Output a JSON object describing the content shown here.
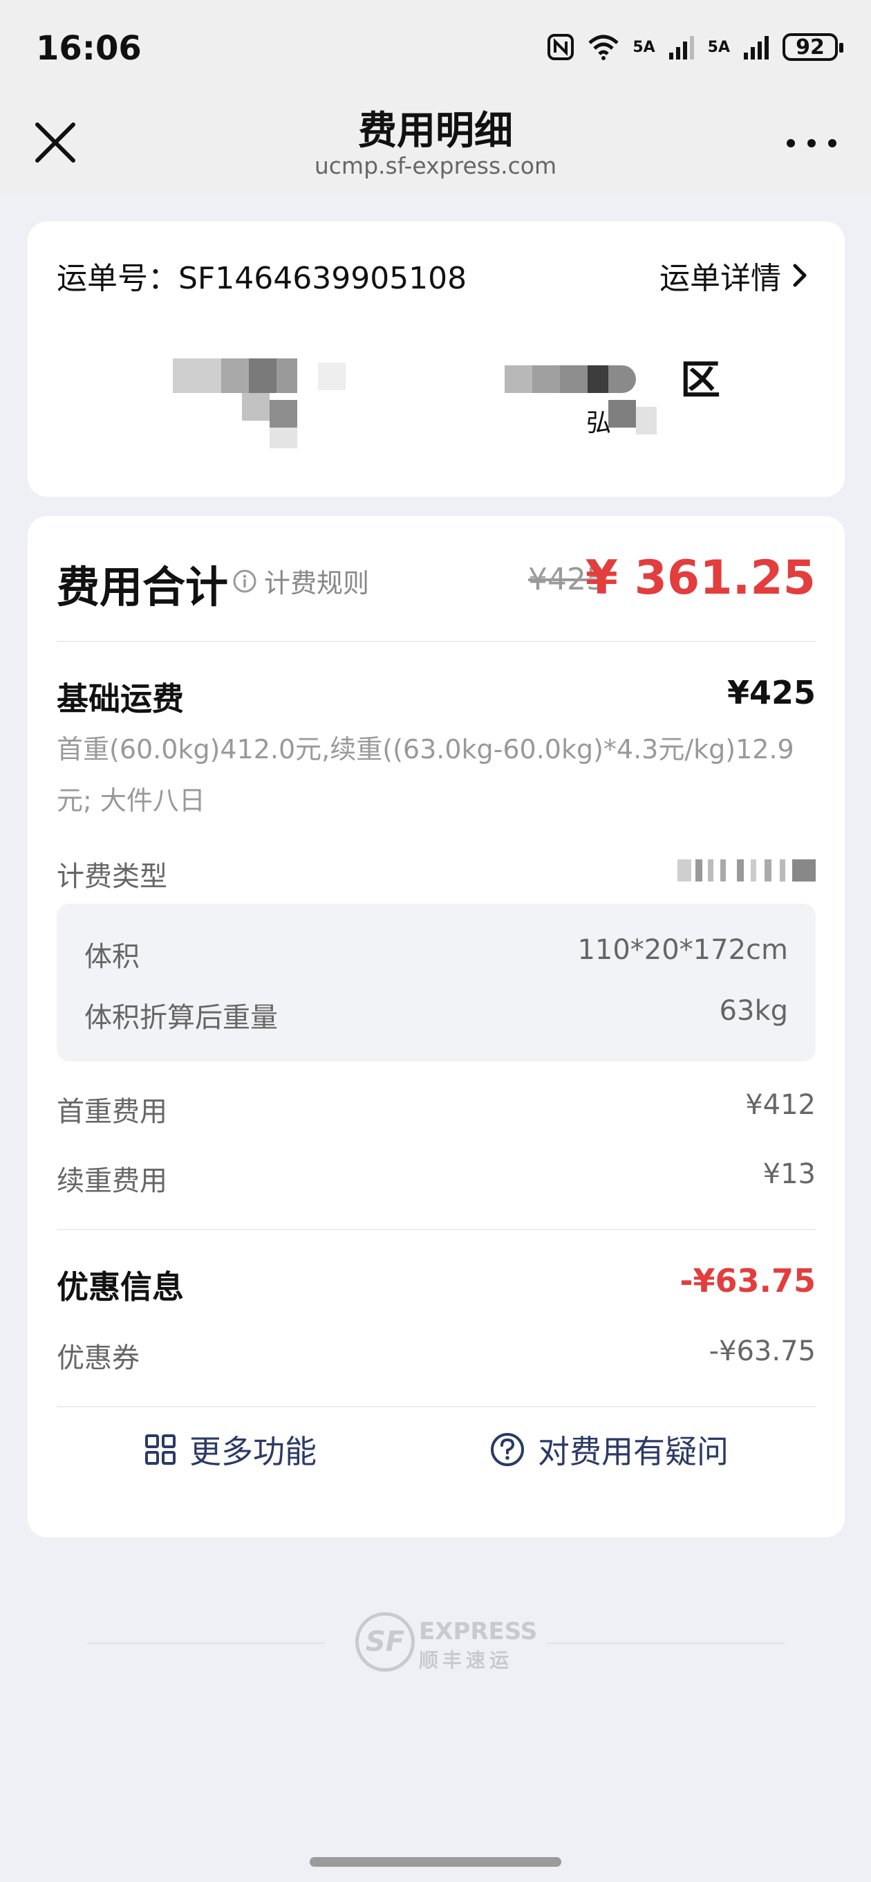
{
  "status_bar": {
    "time": "16:06",
    "network_label_1": "5A",
    "network_label_2": "5A",
    "battery": "92"
  },
  "nav": {
    "title": "费用明细",
    "url": "ucmp.sf-express.com"
  },
  "waybill": {
    "number_label": "运单号：SF1464639905108",
    "detail_link": "运单详情",
    "dest_addr_fragment": "区",
    "dest_sub_fragment": "弘"
  },
  "fees": {
    "total_label": "费用合计",
    "rule_link": "计费规则",
    "original_price": "¥425",
    "final_price": "¥ 361.25",
    "base": {
      "title": "基础运费",
      "amount": "¥425",
      "description": "首重(60.0kg)412.0元,续重((63.0kg-60.0kg)*4.3元/kg)12.9元; 大件八日"
    },
    "billing_type_label": "计费类型",
    "volume": {
      "volume_label": "体积",
      "volume_value": "110*20*172cm",
      "weight_label": "体积折算后重量",
      "weight_value": "63kg"
    },
    "first_weight_label": "首重费用",
    "first_weight_value": "¥412",
    "extra_weight_label": "续重费用",
    "extra_weight_value": "¥13",
    "discount": {
      "title": "优惠信息",
      "amount": "-¥63.75",
      "coupon_label": "优惠券",
      "coupon_value": "-¥63.75"
    },
    "more_functions": "更多功能",
    "fee_question": "对费用有疑问"
  },
  "footer_logo": {
    "badge": "SF",
    "en": "EXPRESS",
    "cn": "顺丰速运"
  },
  "colors": {
    "accent_red": "#e33d3d",
    "link_navy": "#2b3a66",
    "background": "#eef0f5"
  }
}
